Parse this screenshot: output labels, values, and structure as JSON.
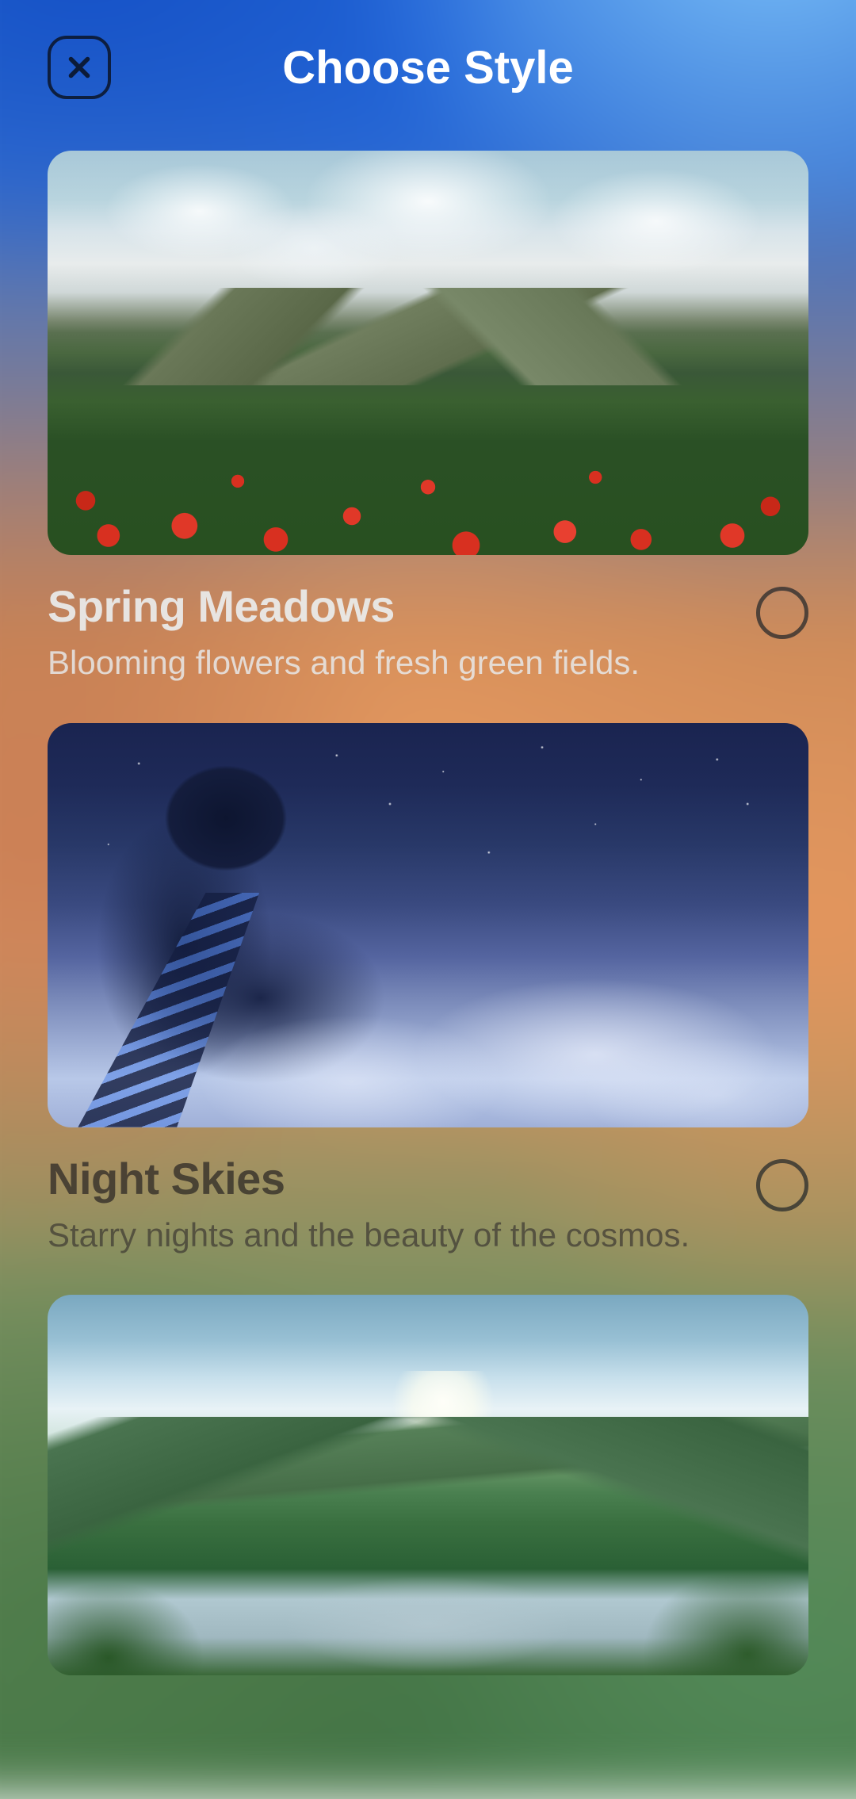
{
  "header": {
    "title": "Choose Style"
  },
  "styles": [
    {
      "title": "Spring Meadows",
      "description": "Blooming flowers and fresh green fields.",
      "selected": false
    },
    {
      "title": "Night Skies",
      "description": "Starry nights and the beauty of the cosmos.",
      "selected": false
    },
    {
      "title": "",
      "description": "",
      "selected": false
    }
  ]
}
